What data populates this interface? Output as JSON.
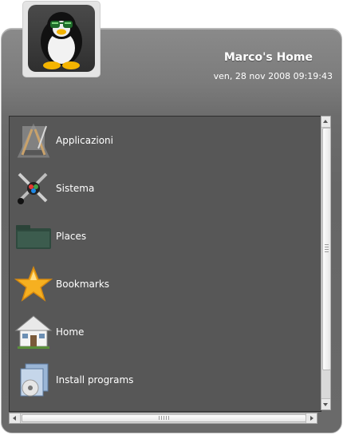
{
  "header": {
    "title": "Marco's Home",
    "datetime": "ven, 28 nov 2008 09:19:43",
    "avatar_icon": "tux-penguin-sunglasses-icon"
  },
  "menu": {
    "items": [
      {
        "label": "Applicazioni",
        "icon": "applications-icon"
      },
      {
        "label": "Sistema",
        "icon": "system-tools-icon"
      },
      {
        "label": "Places",
        "icon": "places-folder-icon"
      },
      {
        "label": "Bookmarks",
        "icon": "star-icon"
      },
      {
        "label": "Home",
        "icon": "house-icon"
      },
      {
        "label": "Install programs",
        "icon": "install-package-icon"
      }
    ]
  },
  "colors": {
    "panel": "#6c6c6c",
    "list_bg": "#575757",
    "text": "#ffffff"
  }
}
